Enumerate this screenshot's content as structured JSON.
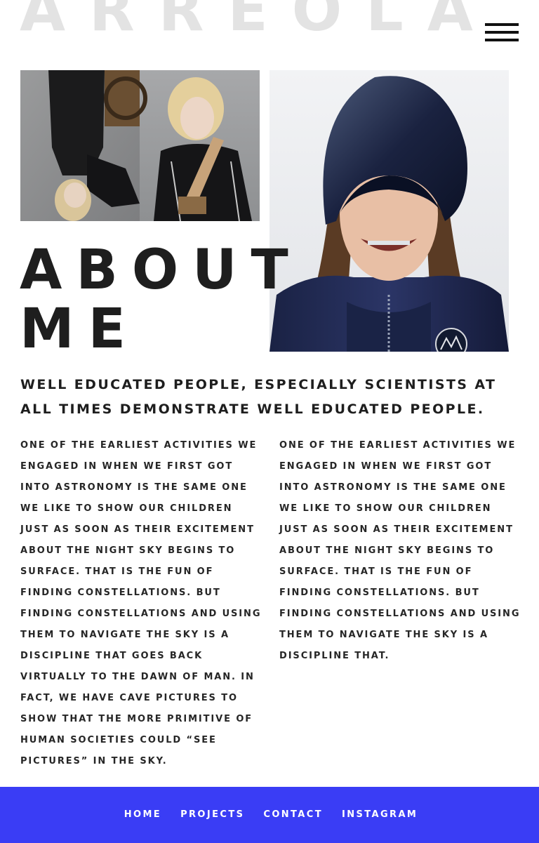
{
  "brand": {
    "name": "ARREOLA"
  },
  "header": {
    "menu_icon": "hamburger-menu-icon"
  },
  "images": {
    "collage_alt": "Two fashion photos: upside-down model in black jacket; blond model in black glossy jacket with bag",
    "portrait_alt": "Model in navy hooded jacket with braces and mountain logo patch"
  },
  "about": {
    "heading_line1": "ABOUT",
    "heading_line2": "ME",
    "lead": "WELL EDUCATED PEOPLE, ESPECIALLY SCIENTISTS AT ALL TIMES DEMONSTRATE WELL EDUCATED PEOPLE.",
    "col_left": "ONE OF THE EARLIEST ACTIVITIES WE ENGAGED IN WHEN WE FIRST GOT INTO ASTRONOMY IS THE SAME ONE WE LIKE TO SHOW OUR CHILDREN JUST AS SOON AS THEIR EXCITEMENT ABOUT THE NIGHT SKY BEGINS TO SURFACE. THAT IS THE FUN OF FINDING CONSTELLATIONS. BUT FINDING CONSTELLATIONS AND USING THEM TO NAVIGATE THE SKY IS A DISCIPLINE THAT GOES BACK VIRTUALLY TO THE DAWN OF MAN. IN FACT, WE HAVE CAVE PICTURES TO SHOW THAT THE MORE PRIMITIVE OF HUMAN SOCIETIES COULD “SEE PICTURES” IN THE SKY.",
    "col_right": "ONE OF THE EARLIEST ACTIVITIES WE ENGAGED IN WHEN WE FIRST GOT INTO ASTRONOMY IS THE SAME ONE WE LIKE TO SHOW OUR CHILDREN JUST AS SOON AS THEIR EXCITEMENT ABOUT THE NIGHT SKY BEGINS TO SURFACE. THAT IS THE FUN OF FINDING CONSTELLATIONS. BUT FINDING CONSTELLATIONS AND USING THEM TO NAVIGATE THE SKY IS A DISCIPLINE THAT."
  },
  "footer": {
    "nav": [
      "HOME",
      "PROJECTS",
      "CONTACT",
      "INSTAGRAM"
    ]
  },
  "colors": {
    "footer_bg": "#3a3df5",
    "brand_text": "#e3e3e3",
    "body_text": "#1e1e1e"
  }
}
